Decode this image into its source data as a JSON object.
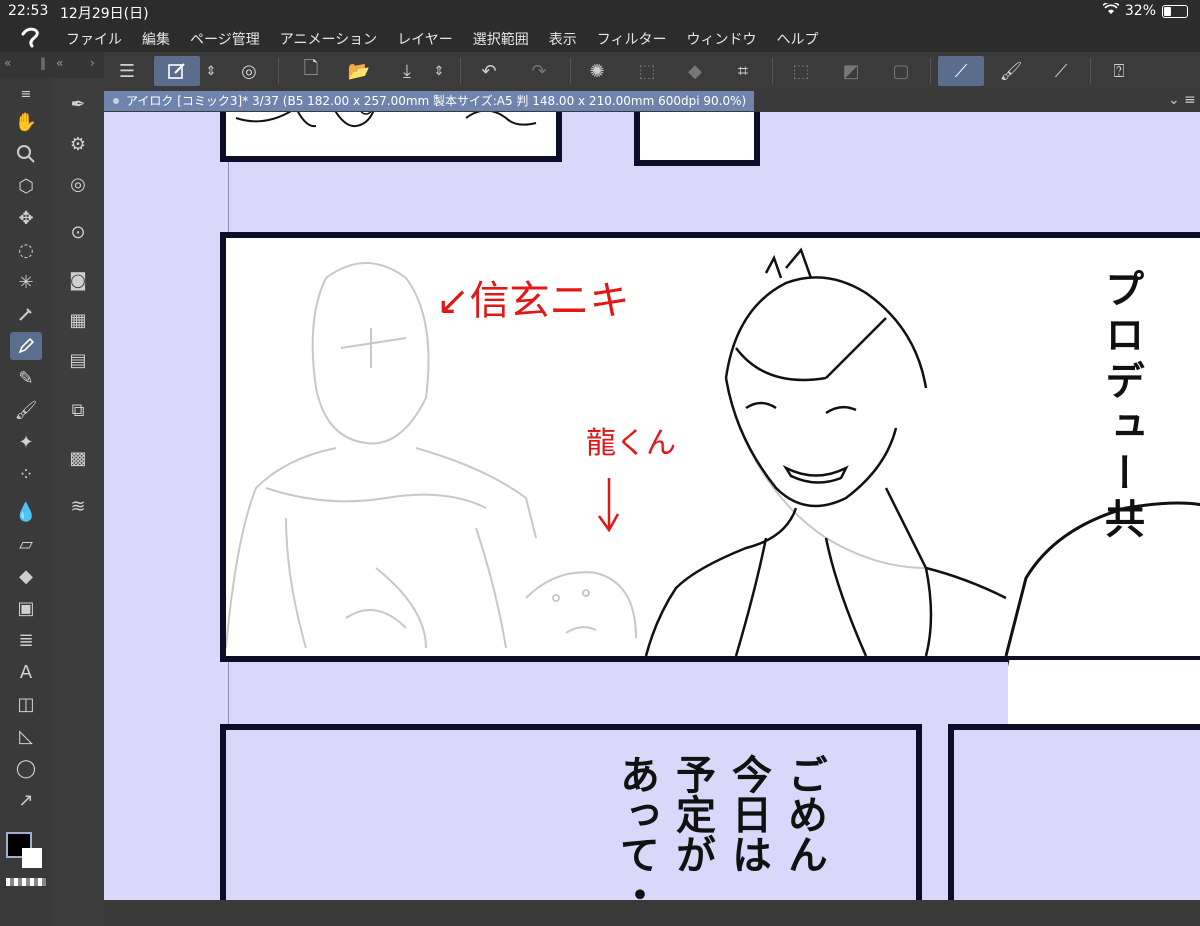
{
  "status": {
    "time": "22:53",
    "date": "12月29日(日)",
    "battery": "32%"
  },
  "menu": [
    "ファイル",
    "編集",
    "ページ管理",
    "アニメーション",
    "レイヤー",
    "選択範囲",
    "表示",
    "フィルター",
    "ウィンドウ",
    "ヘルプ"
  ],
  "document": {
    "title": "アイロク [コミック3]* 3/37 (B5 182.00 x 257.00mm 製本サイズ:A5 判 148.00 x 210.00mm 600dpi 90.0%)"
  },
  "canvas": {
    "vertical_text_1": "プロデュー共",
    "vertical_text_2_col1": "ごめん",
    "vertical_text_2_col2": "今日は",
    "vertical_text_2_col3": "予定が",
    "vertical_text_2_col4": "あって・",
    "red_note_1": "↙信玄ニキ",
    "red_note_2": "龍くん"
  },
  "colors": {
    "accent": "#5b6d8c",
    "canvas_bg": "#d9d8fa",
    "panel_border": "#0c0d26",
    "red_ink": "#e01818"
  },
  "icons": {
    "left_column_1": [
      "hand-icon",
      "zoom-icon",
      "object-icon",
      "move-icon",
      "lasso-icon",
      "magic-wand-icon",
      "eyedropper-icon",
      "pen-icon",
      "pencil-icon",
      "brush-icon",
      "airbrush-icon",
      "decoration-icon",
      "blend-icon",
      "eraser-icon",
      "fill-icon",
      "gradient-icon",
      "figure-icon",
      "text-icon",
      "frame-icon",
      "ruler-icon",
      "balloon-icon",
      "correct-line-icon"
    ],
    "toolbar": [
      "menu-icon",
      "edit-icon",
      "chevron-updown-icon",
      "subview-icon",
      "new-icon",
      "open-icon",
      "save-icon",
      "undo-icon",
      "redo-icon",
      "loading-icon",
      "transform-icon",
      "fill-icon",
      "crop-icon",
      "select-icon",
      "select-all-icon",
      "deselect-icon",
      "pen-select-icon",
      "brush-select-icon",
      "ruler-select-icon",
      "help-icon"
    ]
  }
}
